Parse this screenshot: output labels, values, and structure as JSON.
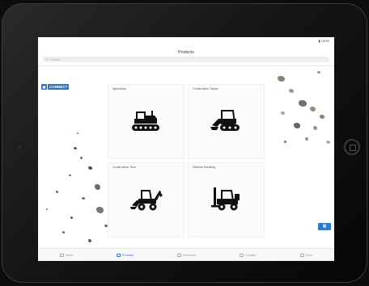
{
  "status_bar": {
    "battery": "▮ 100%"
  },
  "nav": {
    "title": "Products"
  },
  "search": {
    "placeholder": "Search"
  },
  "brand": {
    "logo_text": "CONNECT"
  },
  "tiles": [
    {
      "label": "Agriculture",
      "icon": "crawler-tractor-icon"
    },
    {
      "label": "Construction Tracks",
      "icon": "compact-track-loader-icon"
    },
    {
      "label": "Construction Tires",
      "icon": "backhoe-loader-icon"
    },
    {
      "label": "Material Handling",
      "icon": "forklift-icon"
    }
  ],
  "tab_bar": {
    "items": [
      {
        "label": "News"
      },
      {
        "label": "Products"
      },
      {
        "label": "Brochures"
      },
      {
        "label": "Updates"
      },
      {
        "label": "More"
      }
    ],
    "active_index": 1
  },
  "colors": {
    "accent": "#2f7ad0",
    "logo": "#3b6fb6",
    "bezel": "#1a1a1a"
  }
}
